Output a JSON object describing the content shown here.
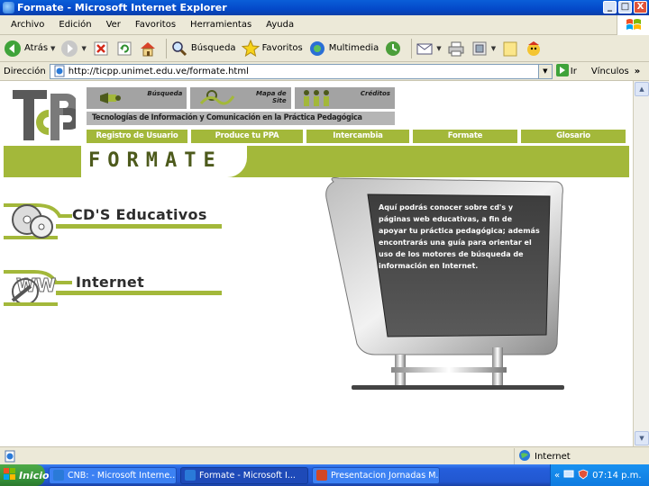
{
  "window": {
    "title": "Formate - Microsoft Internet Explorer",
    "buttons": {
      "minimize": "_",
      "maximize": "□",
      "close": "X"
    }
  },
  "menu": [
    "Archivo",
    "Edición",
    "Ver",
    "Favoritos",
    "Herramientas",
    "Ayuda"
  ],
  "toolbar": {
    "back": "Atrás",
    "search": "Búsqueda",
    "favorites": "Favoritos",
    "multimedia": "Multimedia"
  },
  "address": {
    "label": "Dirección",
    "url": "http://ticpp.unimet.edu.ve/formate.html",
    "go": "Ir",
    "links": "Vínculos",
    "links_chevron": "»"
  },
  "page": {
    "logo_text": "TIC PP",
    "header_tiles": [
      "Búsqueda",
      "Mapa de Site",
      "Créditos"
    ],
    "tagline": "Tecnologías de Información y Comunicación en la Práctica Pedagógica",
    "nav": [
      "Registro de Usuario",
      "Produce tu PPA",
      "Intercambia",
      "Formate",
      "Glosario"
    ],
    "banner_title": "FORMATE",
    "sections": [
      {
        "title": "CD'S Educativos"
      },
      {
        "title": "Internet"
      }
    ],
    "monitor_text": "Aquí podrás conocer sobre cd's y páginas web educativas, a fin de apoyar tu práctica pedagógica; además encontrarás una guía para orientar el uso de los motores de búsqueda de información en Internet."
  },
  "status": {
    "zone": "Internet"
  },
  "taskbar": {
    "start": "Inicio",
    "tasks": [
      {
        "label": "CNB: - Microsoft Interne...",
        "active": false
      },
      {
        "label": "Formate - Microsoft I...",
        "active": true
      },
      {
        "label": "Presentacion Jornadas M...",
        "active": false
      }
    ],
    "tray_chevron": "«",
    "clock": "07:14 p.m."
  },
  "colors": {
    "accent_green": "#a3b83a",
    "dark_green_text": "#4d5a1c",
    "xp_blue": "#0a5ed8"
  }
}
